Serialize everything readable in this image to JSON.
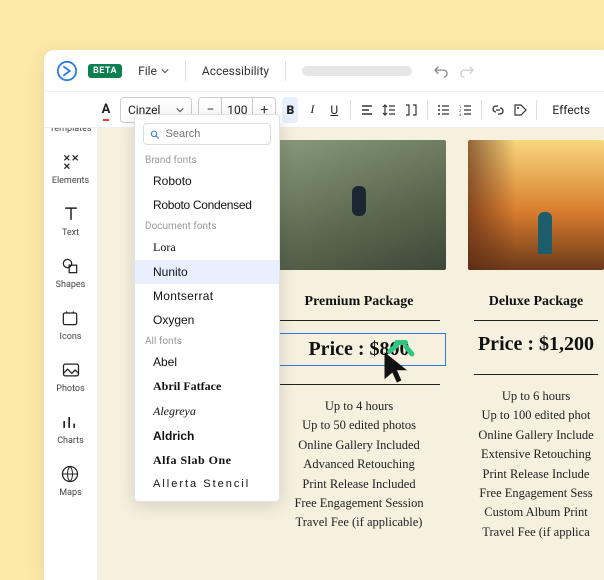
{
  "header": {
    "beta_label": "BETA",
    "file_label": "File",
    "accessibility_label": "Accessibility"
  },
  "toolbar": {
    "font_selected": "Cinzel",
    "font_size": "100",
    "effects_label": "Effects"
  },
  "sidebar": {
    "items": [
      {
        "label": "Templates"
      },
      {
        "label": "Elements"
      },
      {
        "label": "Text"
      },
      {
        "label": "Shapes"
      },
      {
        "label": "Icons"
      },
      {
        "label": "Photos"
      },
      {
        "label": "Charts"
      },
      {
        "label": "Maps"
      }
    ]
  },
  "font_dropdown": {
    "search_placeholder": "Search",
    "section_brand": "Brand fonts",
    "section_doc": "Document fonts",
    "section_all": "All fonts",
    "brand": [
      "Roboto",
      "Roboto Condensed"
    ],
    "doc": [
      "Lora",
      "Nunito",
      "Montserrat",
      "Oxygen"
    ],
    "all": [
      "Abel",
      "Abril Fatface",
      "Alegreya",
      "Aldrich",
      "Alfa Slab One",
      "Allerta Stencil"
    ]
  },
  "canvas": {
    "cards": [
      {
        "title": "Premium Package",
        "price": "Price : $800",
        "lines": [
          "Up to 4 hours",
          "Up to 50 edited photos",
          "Online Gallery Included",
          "Advanced Retouching",
          "Print Release Included",
          "Free Engagement Session",
          "Travel Fee (if applicable)"
        ]
      },
      {
        "title": "Deluxe Package",
        "price": "Price : $1,200",
        "lines": [
          "Up to 6 hours",
          "Up to 100 edited phot",
          "Online Gallery Include",
          "Extensive Retouching",
          "Print Release Include",
          "Free Engagement Sess",
          "Custom Album Print",
          "Travel Fee (if applica"
        ]
      }
    ]
  }
}
